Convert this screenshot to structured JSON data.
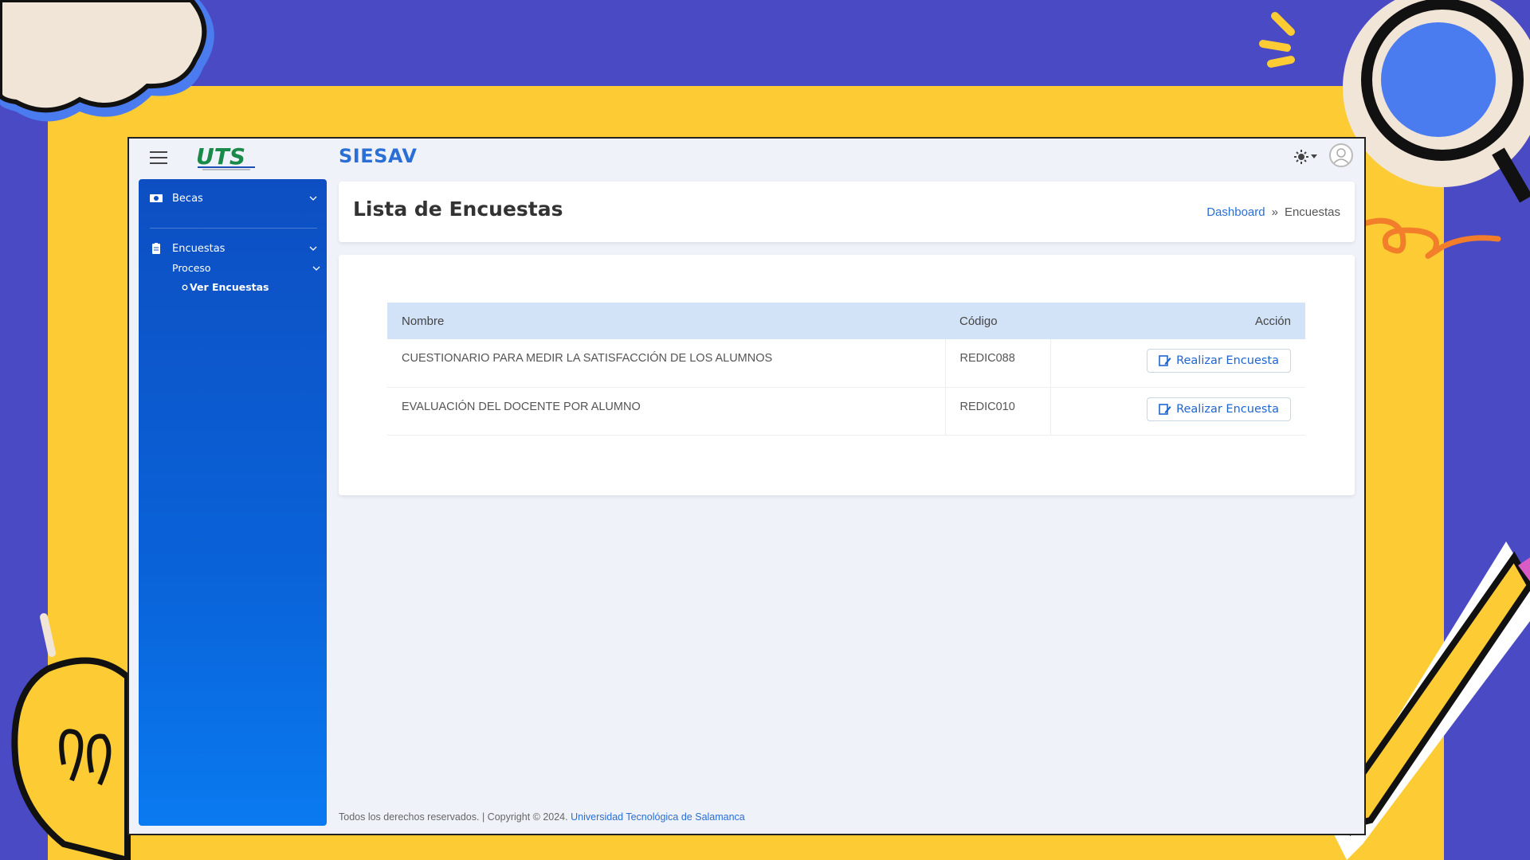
{
  "app": {
    "title": "SIESAV",
    "logo_text": "UTS"
  },
  "sidebar": {
    "items": [
      {
        "label": "Becas",
        "icon": "money-icon"
      },
      {
        "label": "Encuestas",
        "icon": "clipboard-icon"
      }
    ],
    "submenu": {
      "group_label": "Proceso",
      "active_item": "Ver Encuestas"
    }
  },
  "header": {
    "page_title": "Lista de Encuestas",
    "breadcrumb": {
      "home": "Dashboard",
      "separator": "»",
      "current": "Encuestas"
    }
  },
  "table": {
    "columns": [
      "Nombre",
      "Código",
      "Acción"
    ],
    "rows": [
      {
        "nombre": "CUESTIONARIO PARA MEDIR LA SATISFACCIÓN DE LOS ALUMNOS",
        "codigo": "REDIC088",
        "accion": "Realizar Encuesta"
      },
      {
        "nombre": "EVALUACIÓN DEL DOCENTE POR ALUMNO",
        "codigo": "REDIC010",
        "accion": "Realizar Encuesta"
      }
    ]
  },
  "footer": {
    "text": "Todos los derechos reservados. | Copyright © 2024.",
    "link": "Universidad Tecnológica de Salamanca"
  },
  "colors": {
    "brand": "#2a6fd6",
    "sidebar": "#0d4fc2",
    "table_header": "#d3e3f7",
    "background": "#4a4ac4",
    "frame": "#fdcb33"
  }
}
